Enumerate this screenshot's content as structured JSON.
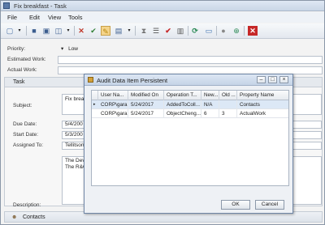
{
  "window": {
    "title": "Fix breakfast - Task"
  },
  "menu": [
    "File",
    "Edit",
    "View",
    "Tools"
  ],
  "form": {
    "priority": {
      "label": "Priority:",
      "value": "Low",
      "arrow": "▾"
    },
    "estimated_work": {
      "label": "Estimated Work:"
    },
    "actual_work": {
      "label": "Actual Work:"
    },
    "task_group": {
      "label": "Task"
    },
    "subject": {
      "label": "Subject:",
      "value": "Fix brea"
    },
    "due_date": {
      "label": "Due Date:",
      "value": "5/4/200"
    },
    "start_date": {
      "label": "Start Date:",
      "value": "5/3/200"
    },
    "assigned_to": {
      "label": "Assigned To:",
      "value": "Tellitson"
    },
    "description": {
      "label": "Description:",
      "lines": [
        "The Devel",
        "The R&QA"
      ]
    }
  },
  "bottom_tab": {
    "label": "Contacts"
  },
  "dialog": {
    "title": "Audit Data Item Persistent",
    "columns": [
      "User Na...",
      "Modified On",
      "Operation T...",
      "New...",
      "Old ...",
      "Property Name"
    ],
    "rows": [
      {
        "user": "CORP\\gara...",
        "modified": "5/24/2017",
        "operation": "AddedToColl...",
        "new": "N/A",
        "old": "",
        "property": "Contacts",
        "selected": true
      },
      {
        "user": "CORP\\gara...",
        "modified": "5/24/2017",
        "operation": "ObjectCheng...",
        "new": "6",
        "old": "3",
        "property": "ActualWork",
        "selected": false
      }
    ],
    "ok_label": "OK",
    "cancel_label": "Cancel"
  },
  "colors": {
    "accent": "#5a7aa8",
    "selected_row": "#dce8f6"
  }
}
